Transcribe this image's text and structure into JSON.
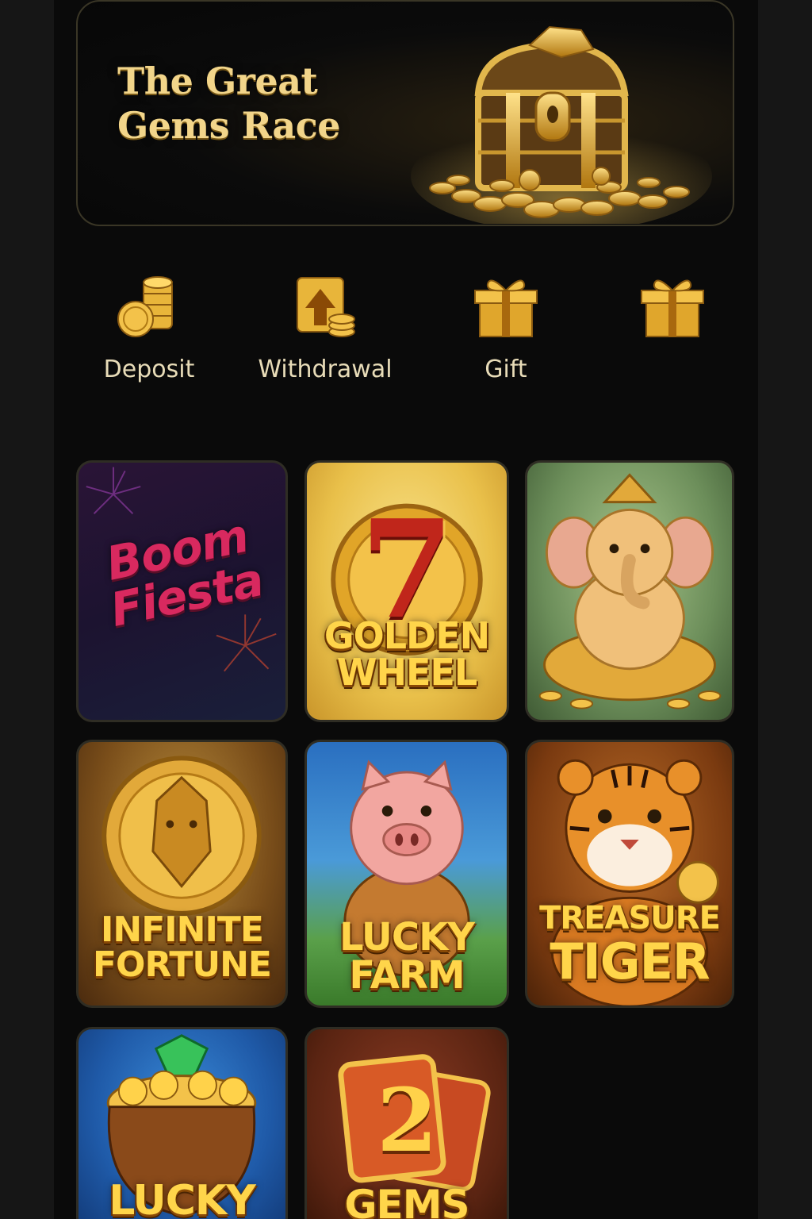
{
  "banner": {
    "title_line1": "The Great",
    "title_line2": "Gems Race",
    "icon": "treasure-chest"
  },
  "quick_actions": [
    {
      "label": "Deposit",
      "icon": "coins-stack-icon"
    },
    {
      "label": "Withdrawal",
      "icon": "withdraw-arrow-icon"
    },
    {
      "label": "Gift",
      "icon": "gift-icon"
    },
    {
      "label": "",
      "icon": "gift-icon"
    }
  ],
  "games": [
    {
      "title_line1": "Boom",
      "title_line2": "Fiesta"
    },
    {
      "title_line1": "GOLDEN",
      "title_line2": "WHEEL",
      "badge": "7"
    },
    {
      "title_line1": "",
      "title_line2": "",
      "art": "ganesha"
    },
    {
      "title_line1": "INFINITE",
      "title_line2": "FORTUNE"
    },
    {
      "title_line1": "LUCKY",
      "title_line2": "FARM"
    },
    {
      "title_line1": "TREASURE",
      "title_line2": "TIGER"
    },
    {
      "title_line1": "LUCKY",
      "title_line2": ""
    },
    {
      "title_line1": "GEMS",
      "title_line2": "",
      "badge": "2"
    }
  ],
  "colors": {
    "accent_gold": "#f2d58a",
    "background": "#0a0a0a",
    "label": "#e8dcb8"
  }
}
